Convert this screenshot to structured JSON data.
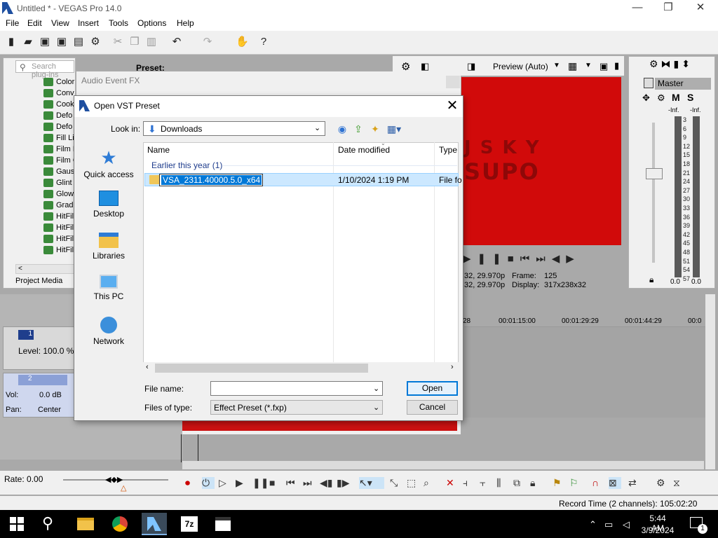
{
  "app": {
    "title": "Untitled * - VEGAS Pro 14.0",
    "window_controls": [
      "—",
      "❐",
      "✕"
    ]
  },
  "menu": [
    "File",
    "Edit",
    "View",
    "Insert",
    "Tools",
    "Options",
    "Help"
  ],
  "plugins": {
    "search_placeholder": "Search plug-ins",
    "preset_label": "Preset:",
    "items": [
      "Color",
      "Conv",
      "Cook",
      "Defo",
      "Defo",
      "Fill Li",
      "Film E",
      "Film G",
      "Gaus",
      "Glint",
      "Glow",
      "Grad",
      "HitFil",
      "HitFil",
      "HitFil",
      "HitFil"
    ],
    "tab_label": "Project Media"
  },
  "audio_fx": {
    "title": "Audio Event FX"
  },
  "preview": {
    "mode": "Preview (Auto)",
    "overlay_text_top": "J  S  K  Y",
    "overlay_text_bottom": "SUPO",
    "info1_left": "32, 29.970p",
    "info1_key": "Frame:",
    "info1_val": "125",
    "info2_left": "32, 29.970p",
    "info2_key": "Display:",
    "info2_val": "317x238x32"
  },
  "master": {
    "label": "Master",
    "m": "M",
    "s": "S",
    "inf_left": "-Inf.",
    "inf_right": "-Inf.",
    "scale": [
      "3",
      "6",
      "9",
      "12",
      "15",
      "18",
      "21",
      "24",
      "27",
      "30",
      "33",
      "36",
      "39",
      "42",
      "45",
      "48",
      "51",
      "54",
      "57"
    ],
    "val_left": "0.0",
    "val_right": "0.0"
  },
  "tracks": {
    "t1_num": "1",
    "t1_level": "Level: 100.0 %",
    "t2_num": "2",
    "t2_vol_label": "Vol:",
    "t2_vol_val": "0.0 dB",
    "t2_pan_label": "Pan:",
    "t2_pan_val": "Center"
  },
  "timeline": {
    "timecodes": [
      "28",
      "00:01:15:00",
      "00:01:29:29",
      "00:01:44:29",
      "00:0"
    ]
  },
  "transport": {
    "rate": "Rate: 0.00",
    "record_time": "Record Time (2 channels): 105:02:20"
  },
  "dialog": {
    "title": "Open VST Preset",
    "look_in_label": "Look in:",
    "look_in_value": "Downloads",
    "places": [
      "Quick access",
      "Desktop",
      "Libraries",
      "This PC",
      "Network"
    ],
    "columns": [
      "Name",
      "Date modified",
      "Type"
    ],
    "group_header": "Earlier this year (1)",
    "row": {
      "name": "VSA_2311.40000.5.0_x64",
      "date": "1/10/2024 1:19 PM",
      "type": "File fo"
    },
    "file_name_label": "File name:",
    "file_name_value": "",
    "files_of_type_label": "Files of type:",
    "files_of_type_value": "Effect Preset (*.fxp)",
    "open_label": "Open",
    "cancel_label": "Cancel"
  },
  "taskbar": {
    "time": "5:44 AM",
    "date": "3/9/2024",
    "notification_count": "1"
  }
}
